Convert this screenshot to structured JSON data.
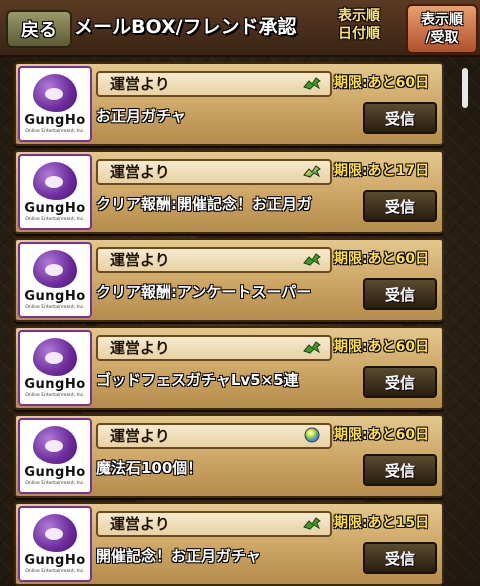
{
  "header": {
    "back_label": "戻る",
    "title": "メールBOX/フレンド承認",
    "sort_label_line1": "表示順",
    "sort_label_line2": "日付順",
    "sort_button_line1": "表示順",
    "sort_button_line2": "/受取"
  },
  "avatar": {
    "logo": "GungHo",
    "sub": "Online Entertainment, Inc."
  },
  "mails": [
    {
      "sender": "運営より",
      "subject": "お正月ガチャ",
      "deadline": "期限:あと60日",
      "button": "受信",
      "icon": "green-dragon-icon"
    },
    {
      "sender": "運営より",
      "subject": "クリア報酬:開催記念！お正月ガ",
      "deadline": "期限:あと17日",
      "button": "受信",
      "icon": "rainbow-dragon-icon"
    },
    {
      "sender": "運営より",
      "subject": "クリア報酬:アンケートスーパー",
      "deadline": "期限:あと60日",
      "button": "受信",
      "icon": "green-dragon-icon"
    },
    {
      "sender": "運営より",
      "subject": "ゴッドフェスガチャLv5×5連",
      "deadline": "期限:あと60日",
      "button": "受信",
      "icon": "green-dragon-icon"
    },
    {
      "sender": "運営より",
      "subject": "魔法石100個！",
      "deadline": "期限:あと60日",
      "button": "受信",
      "icon": "magic-stone-icon"
    },
    {
      "sender": "運営より",
      "subject": "開催記念！お正月ガチャ",
      "deadline": "期限:あと15日",
      "button": "受信",
      "icon": "green-dragon-icon"
    }
  ]
}
